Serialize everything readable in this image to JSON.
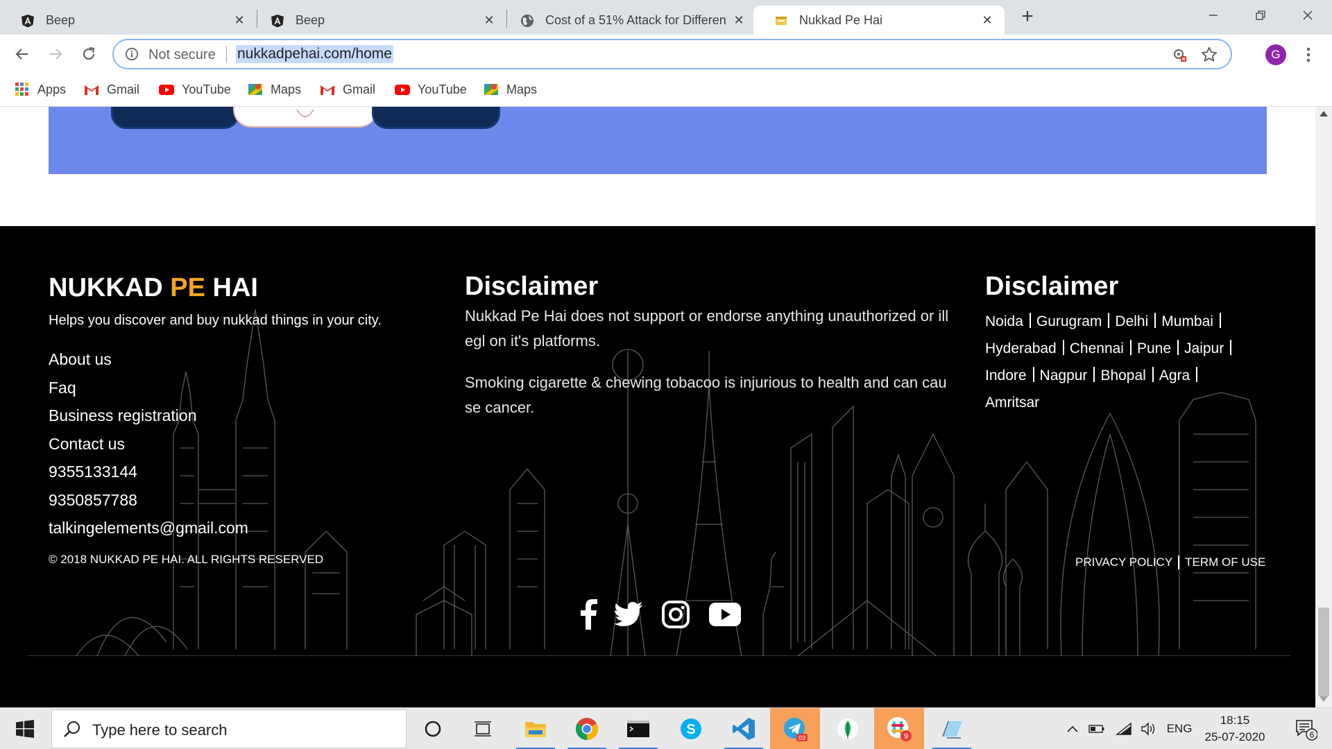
{
  "browser": {
    "tabs": [
      {
        "title": "Beep",
        "favicon": "angular-icon",
        "active": false
      },
      {
        "title": "Beep",
        "favicon": "angular-icon",
        "active": false
      },
      {
        "title": "Cost of a 51% Attack for Differen",
        "favicon": "globe-icon",
        "active": false
      },
      {
        "title": "Nukkad Pe Hai",
        "favicon": "page-icon",
        "active": true
      }
    ],
    "omnibox": {
      "security_label": "Not secure",
      "url": "nukkadpehai.com/home"
    },
    "profile_initial": "G",
    "bookmarks": [
      {
        "label": "Apps",
        "icon": "apps-grid-icon"
      },
      {
        "label": "Gmail",
        "icon": "gmail-icon"
      },
      {
        "label": "YouTube",
        "icon": "youtube-icon"
      },
      {
        "label": "Maps",
        "icon": "maps-icon"
      },
      {
        "label": "Gmail",
        "icon": "gmail-icon"
      },
      {
        "label": "YouTube",
        "icon": "youtube-icon"
      },
      {
        "label": "Maps",
        "icon": "maps-icon"
      }
    ]
  },
  "footer": {
    "brand": {
      "part1": "NUKKAD ",
      "part2": "PE",
      "part3": " HAI"
    },
    "tagline": "Helps you discover and buy nukkad things in your city.",
    "links": [
      "About us",
      "Faq",
      "Business registration",
      "Contact us",
      "9355133144",
      "9350857788",
      "talkingelements@gmail.com"
    ],
    "disclaimer": {
      "title": "Disclaimer",
      "paragraphs": [
        "Nukkad Pe Hai does not support or endorse anything unauthorized or illegl on it's platforms.",
        "Smoking cigarette & chewing tobacoo is injurious to health and can cause cancer."
      ]
    },
    "cities_block": {
      "title": "Disclaimer",
      "cities": [
        "Noida",
        "Gurugram",
        "Delhi",
        "Mumbai",
        "Hyderabad",
        "Chennai",
        "Pune",
        "Jaipur",
        "Indore",
        "Nagpur",
        "Bhopal",
        "Agra",
        "Amritsar"
      ]
    },
    "social": [
      "facebook-icon",
      "twitter-icon",
      "instagram-icon",
      "youtube-icon"
    ],
    "copyright": "© 2018 NUKKAD PE HAI. ALL RIGHTS RESERVED",
    "legal": {
      "privacy": "PRIVACY POLICY",
      "terms": "TERM OF USE"
    },
    "colors": {
      "background": "#000000",
      "accent": "#f5a623",
      "banner": "#6b88ea"
    }
  },
  "taskbar": {
    "search_placeholder": "Type here to search",
    "apps": [
      "cortana-icon",
      "task-view-icon",
      "file-explorer-icon",
      "chrome-icon",
      "terminal-icon",
      "skype-icon",
      "vscode-icon",
      "telegram-icon",
      "mongodb-icon",
      "slack-icon",
      "notepad-icon"
    ],
    "telegram_badge": "03",
    "slack_badge": "9",
    "language": "ENG",
    "time": "18:15",
    "date": "25-07-2020",
    "notification_count": "6"
  }
}
